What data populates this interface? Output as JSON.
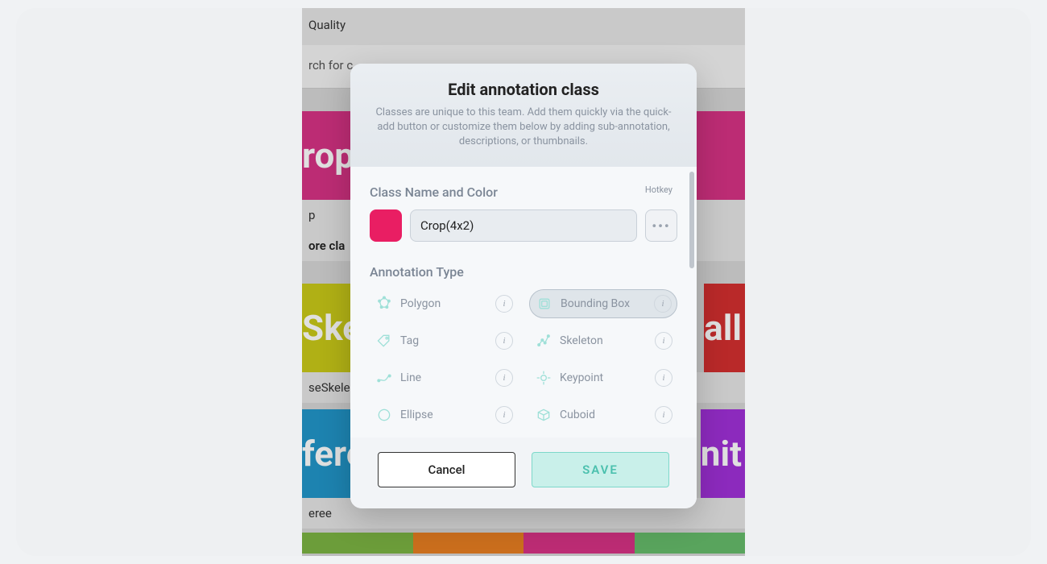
{
  "background": {
    "header": "Quality",
    "search": "rch for c",
    "tile1": "rop",
    "label1": "p",
    "headrow": "ore cla",
    "tile2": "Ske",
    "tile3": "all",
    "label2": "seSkele",
    "tile4": "fere",
    "tile5": "nit",
    "label3": "eree",
    "colors": {
      "crop": "#d63384",
      "ske": "#c9c919",
      "all": "#d32f2f",
      "fere": "#2196c9",
      "nit": "#a030d8",
      "s1": "#7cb342",
      "s2": "#e67e22",
      "s3": "#d63384",
      "s4": "#66bb6a"
    }
  },
  "modal": {
    "title": "Edit annotation class",
    "subtitle": "Classes are unique to this team. Add them quickly via the quick-add button or customize them below by adding sub-annotation, descriptions, or thumbnails.",
    "section_name": "Class Name and Color",
    "class_name": "Crop(4x2)",
    "class_color": "#e91e63",
    "hotkey_label": "Hotkey",
    "hotkey_value": "•••",
    "section_type": "Annotation Type",
    "types": [
      {
        "label": "Polygon",
        "selected": false
      },
      {
        "label": "Bounding Box",
        "selected": true
      },
      {
        "label": "Tag",
        "selected": false
      },
      {
        "label": "Skeleton",
        "selected": false
      },
      {
        "label": "Line",
        "selected": false
      },
      {
        "label": "Keypoint",
        "selected": false
      },
      {
        "label": "Ellipse",
        "selected": false
      },
      {
        "label": "Cuboid",
        "selected": false
      }
    ],
    "cancel": "Cancel",
    "save": "SAVE",
    "info": "i"
  }
}
